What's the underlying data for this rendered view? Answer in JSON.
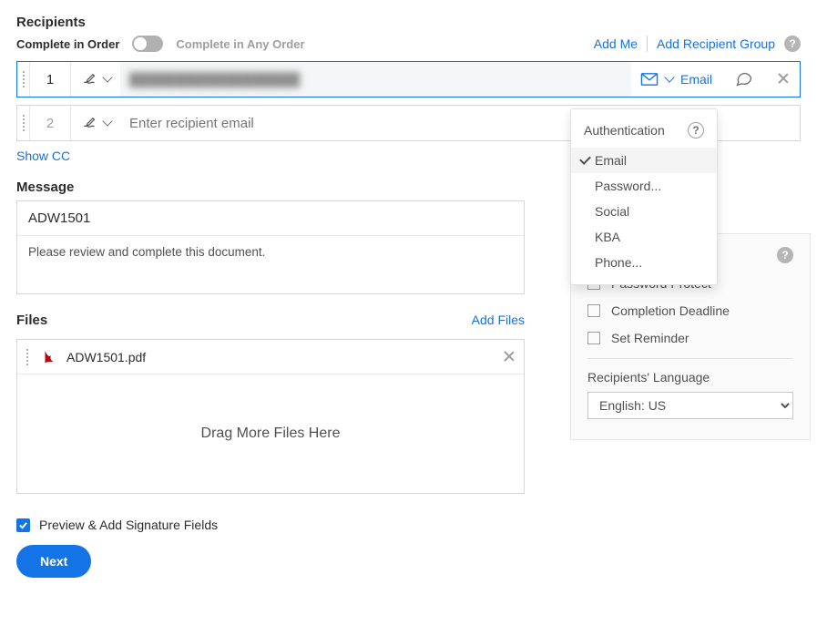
{
  "recipients": {
    "title": "Recipients",
    "order_label": "Complete in Order",
    "any_order_label": "Complete in Any Order",
    "add_me": "Add Me",
    "add_group": "Add Recipient Group",
    "rows": [
      {
        "num": "1",
        "email": "██████████████████",
        "auth_label": "Email"
      },
      {
        "num": "2",
        "email_placeholder": "Enter recipient email"
      }
    ],
    "show_cc": "Show CC"
  },
  "auth_dropdown": {
    "title": "Authentication",
    "items": [
      "Email",
      "Password...",
      "Social",
      "KBA",
      "Phone..."
    ],
    "selected": "Email"
  },
  "message": {
    "title": "Message",
    "subject": "ADW1501",
    "body": "Please review and complete this document."
  },
  "files": {
    "title": "Files",
    "add_files": "Add Files",
    "items": [
      "ADW1501.pdf"
    ],
    "drop_hint": "Drag More Files Here"
  },
  "options": {
    "password_protect": "Password Protect",
    "completion_deadline": "Completion Deadline",
    "set_reminder": "Set Reminder",
    "lang_label": "Recipients' Language",
    "lang_value": "English: US"
  },
  "footer": {
    "preview_label": "Preview & Add Signature Fields",
    "next": "Next"
  }
}
